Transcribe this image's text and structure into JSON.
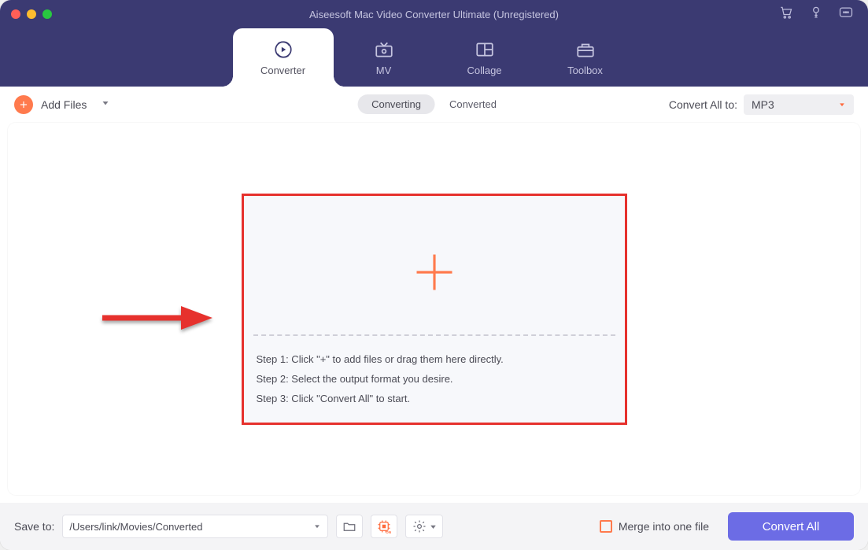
{
  "title": "Aiseesoft Mac Video Converter Ultimate (Unregistered)",
  "tabs": {
    "converter": "Converter",
    "mv": "MV",
    "collage": "Collage",
    "toolbox": "Toolbox"
  },
  "toolbar": {
    "add_files": "Add Files",
    "segment_converting": "Converting",
    "segment_converted": "Converted",
    "convert_all_to_label": "Convert All to:",
    "format_selected": "MP3"
  },
  "dropzone": {
    "step1": "Step 1: Click \"+\" to add files or drag them here directly.",
    "step2": "Step 2: Select the output format you desire.",
    "step3": "Step 3: Click \"Convert All\" to start."
  },
  "bottom": {
    "save_to": "Save to:",
    "path": "/Users/link/Movies/Converted",
    "merge": "Merge into one file",
    "convert_all": "Convert All"
  }
}
